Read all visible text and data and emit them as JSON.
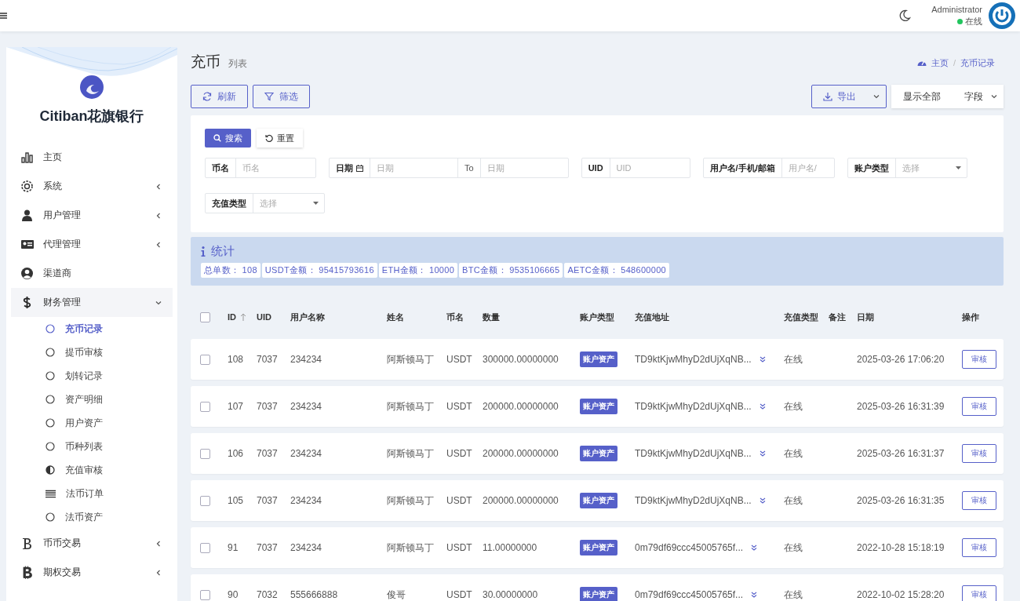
{
  "topbar": {
    "user": {
      "name": "Administrator",
      "status": "在线",
      "color": "#22c55e"
    }
  },
  "sidebar": {
    "brand": "Citiban花旗银行",
    "items": [
      {
        "label": "主页",
        "kind": "link"
      },
      {
        "label": "系统",
        "kind": "group",
        "expanded": false
      },
      {
        "label": "用户管理",
        "kind": "group",
        "expanded": false
      },
      {
        "label": "代理管理",
        "kind": "group",
        "expanded": false
      },
      {
        "label": "渠道商",
        "kind": "link"
      },
      {
        "label": "财务管理",
        "kind": "group",
        "expanded": true,
        "children": [
          {
            "label": "充币记录",
            "selected": true,
            "kind": "circle"
          },
          {
            "label": "提币审核",
            "selected": false,
            "kind": "circle"
          },
          {
            "label": "划转记录",
            "selected": false,
            "kind": "circle"
          },
          {
            "label": "资产明细",
            "selected": false,
            "kind": "circle"
          },
          {
            "label": "用户资产",
            "selected": false,
            "kind": "circle"
          },
          {
            "label": "币种列表",
            "selected": false,
            "kind": "circle"
          },
          {
            "label": "充值审核",
            "selected": false,
            "kind": "half"
          },
          {
            "label": "法币订单",
            "selected": false,
            "kind": "lines"
          },
          {
            "label": "法币资产",
            "selected": false,
            "kind": "circle"
          }
        ]
      },
      {
        "label": "币币交易",
        "kind": "group",
        "expanded": false
      },
      {
        "label": "期权交易",
        "kind": "group",
        "expanded": false
      }
    ]
  },
  "page": {
    "title": "充币",
    "subtitle": "列表",
    "breadcrumb": [
      "主页",
      "充币记录"
    ],
    "breadcrumb_separator": "/"
  },
  "toolbar": {
    "left": [
      "刷新",
      "筛选"
    ],
    "export": "导出",
    "show_all": "显示全部",
    "fields": "字段"
  },
  "filters": {
    "buttons": [
      "搜索",
      "重置"
    ],
    "fields": [
      {
        "kind": "text",
        "label": "币名",
        "placeholder": "币名"
      },
      {
        "kind": "date",
        "label": "日期",
        "placeholder": "日期",
        "separator": "To",
        "placeholder_end": "日期"
      },
      {
        "kind": "text",
        "label": "UID",
        "placeholder": "UID"
      },
      {
        "kind": "text",
        "label": "用户名/手机/邮箱",
        "placeholder": "用户名/"
      },
      {
        "kind": "select",
        "label": "账户类型",
        "placeholder": "选择"
      },
      {
        "kind": "select",
        "label": "充值类型",
        "placeholder": "选择"
      }
    ]
  },
  "stats": {
    "title": "统计",
    "items": [
      {
        "label": "总单数：",
        "value": "108"
      },
      {
        "label": "USDT金额：",
        "value": "95415793616"
      },
      {
        "label": "ETH金额：",
        "value": "10000"
      },
      {
        "label": "BTC金额：",
        "value": "9535106665"
      },
      {
        "label": "AETC金额：",
        "value": "548600000"
      }
    ]
  },
  "table": {
    "select_all": {
      "checked": false
    },
    "columns": [
      {
        "label": "ID",
        "sorted": true
      },
      {
        "label": "UID"
      },
      {
        "label": "用户名称"
      },
      {
        "label": "姓名"
      },
      {
        "label": "币名"
      },
      {
        "label": "数量"
      },
      {
        "label": "账户类型"
      },
      {
        "label": "充值地址"
      },
      {
        "label": "充值类型"
      },
      {
        "label": "备注"
      },
      {
        "label": "日期"
      },
      {
        "label": "操作"
      }
    ],
    "rows": [
      {
        "checked": false,
        "id": "108",
        "uid": "7037",
        "username": "234234",
        "name": "阿斯顿马丁",
        "coin": "USDT",
        "amount": "300000.00000000",
        "account_type": "账户资产",
        "address": "TD9ktKjwMhyD2dUjXqNB...",
        "recharge_type": "在线",
        "date": "2025-03-26 17:06:20",
        "action": "审核"
      },
      {
        "checked": false,
        "id": "107",
        "uid": "7037",
        "username": "234234",
        "name": "阿斯顿马丁",
        "coin": "USDT",
        "amount": "200000.00000000",
        "account_type": "账户资产",
        "address": "TD9ktKjwMhyD2dUjXqNB...",
        "recharge_type": "在线",
        "date": "2025-03-26 16:31:39",
        "action": "审核"
      },
      {
        "checked": false,
        "id": "106",
        "uid": "7037",
        "username": "234234",
        "name": "阿斯顿马丁",
        "coin": "USDT",
        "amount": "200000.00000000",
        "account_type": "账户资产",
        "address": "TD9ktKjwMhyD2dUjXqNB...",
        "recharge_type": "在线",
        "date": "2025-03-26 16:31:37",
        "action": "审核"
      },
      {
        "checked": false,
        "id": "105",
        "uid": "7037",
        "username": "234234",
        "name": "阿斯顿马丁",
        "coin": "USDT",
        "amount": "200000.00000000",
        "account_type": "账户资产",
        "address": "TD9ktKjwMhyD2dUjXqNB...",
        "recharge_type": "在线",
        "date": "2025-03-26 16:31:35",
        "action": "审核"
      },
      {
        "checked": false,
        "id": "91",
        "uid": "7037",
        "username": "234234",
        "name": "阿斯顿马丁",
        "coin": "USDT",
        "amount": "11.00000000",
        "account_type": "账户资产",
        "address": "0m79df69ccc45005765f...",
        "recharge_type": "在线",
        "date": "2022-10-28 15:18:19",
        "action": "审核"
      },
      {
        "checked": false,
        "id": "90",
        "uid": "7032",
        "username": "555666888",
        "name": "俊哥",
        "coin": "USDT",
        "amount": "30.00000000",
        "account_type": "账户资产",
        "address": "0m79df69ccc45005765f...",
        "recharge_type": "在线",
        "date": "2022-10-02 15:28:20",
        "action": "审核"
      }
    ]
  }
}
